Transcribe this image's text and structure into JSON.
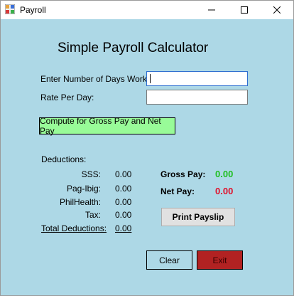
{
  "window": {
    "title": "Payroll",
    "controls": {
      "minimize": "minimize-icon",
      "maximize": "maximize-icon",
      "close": "close-icon"
    }
  },
  "form": {
    "heading": "Simple Payroll Calculator",
    "days_label": "Enter Number of Days Work:",
    "days_value": "",
    "rate_label": "Rate Per Day:",
    "rate_value": "",
    "compute_label": "Compute for Gross Pay and Net Pay"
  },
  "deductions": {
    "title": "Deductions:",
    "items": [
      {
        "label": "SSS:",
        "value": "0.00"
      },
      {
        "label": "Pag-Ibig:",
        "value": "0.00"
      },
      {
        "label": "PhilHealth:",
        "value": "0.00"
      },
      {
        "label": "Tax:",
        "value": "0.00"
      }
    ],
    "total_label": "Total Deductions:",
    "total_value": "0.00"
  },
  "pay": {
    "gross_label": "Gross Pay:",
    "gross_value": "0.00",
    "net_label": "Net Pay:",
    "net_value": "0.00"
  },
  "buttons": {
    "print": "Print Payslip",
    "clear": "Clear",
    "exit": "Exit"
  },
  "colors": {
    "background": "#add8e6",
    "compute_button": "#98fb98",
    "gross_value": "#1fbf1f",
    "net_value": "#e0102a",
    "exit_button": "#b22222"
  }
}
